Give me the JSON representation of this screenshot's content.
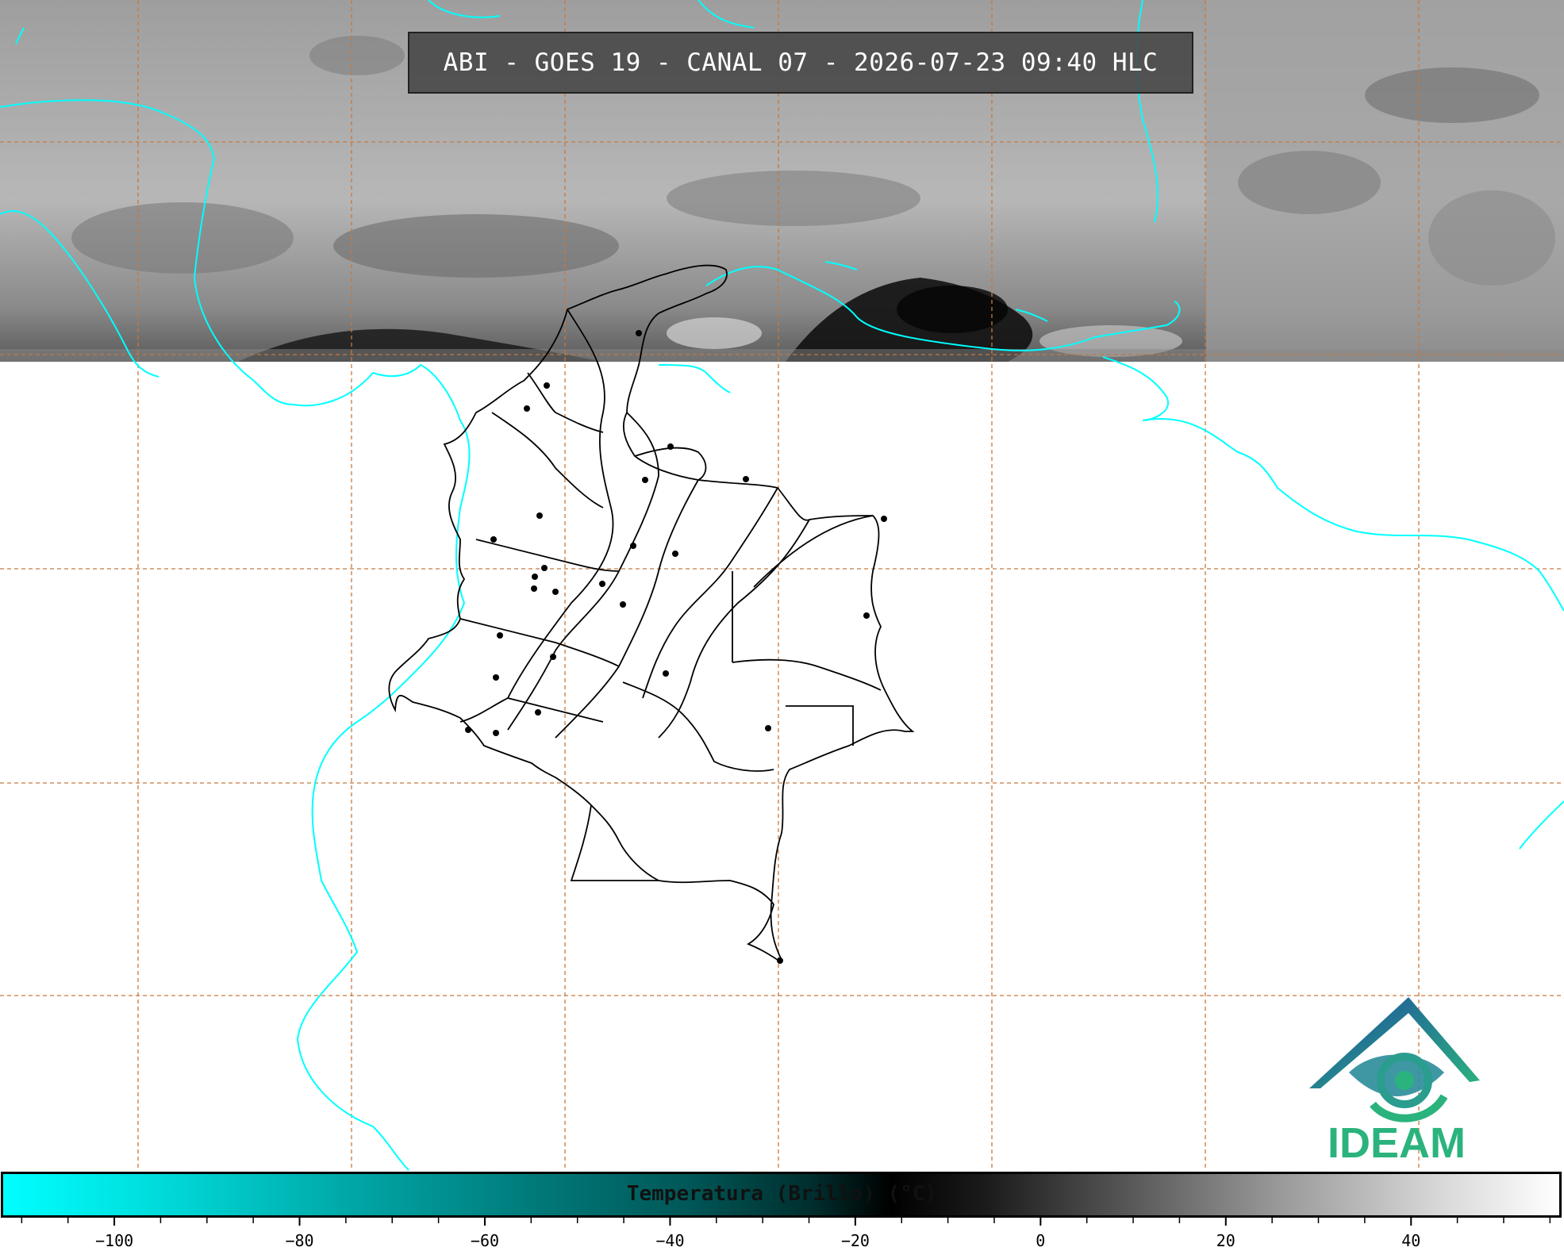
{
  "title": "ABI - GOES 19 - CANAL 07 - 2026-07-23 09:40 HLC",
  "logo": {
    "text": "IDEAM",
    "icon": "ideam-eye-logo"
  },
  "colorbar": {
    "label": "Temperatura (Brillo) (°C)",
    "ticks": [
      "−100",
      "−80",
      "−60",
      "−40",
      "−20",
      "0",
      "20",
      "40"
    ],
    "tick_values": [
      -100,
      -80,
      -60,
      -40,
      -20,
      0,
      20,
      40
    ],
    "range": [
      -112,
      56
    ]
  },
  "colors": {
    "coastline": "#00ffff",
    "gridline": "#c8783c",
    "boundary": "#000000",
    "satellite_band": "#a9a9a9"
  }
}
